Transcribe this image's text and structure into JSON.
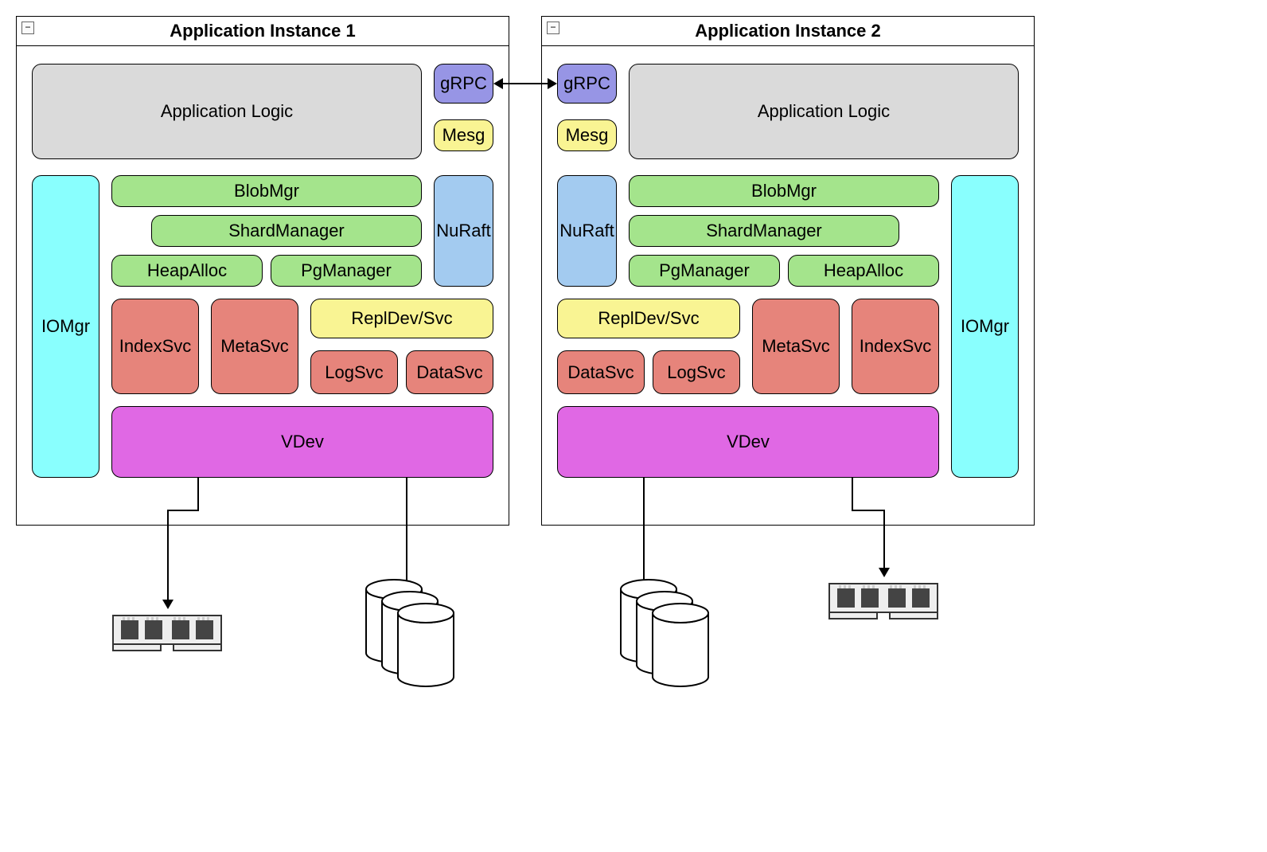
{
  "instance1": {
    "title": "Application Instance 1",
    "appLogic": "Application Logic",
    "grpc": "gRPC",
    "mesg": "Mesg",
    "iomgr": "IOMgr",
    "blobmgr": "BlobMgr",
    "shardmgr": "ShardManager",
    "nuraft": "NuRaft",
    "heapalloc": "HeapAlloc",
    "pgmanager": "PgManager",
    "indexsvc": "IndexSvc",
    "metasvc": "MetaSvc",
    "repldev": "ReplDev/Svc",
    "logsvc": "LogSvc",
    "datasvc": "DataSvc",
    "vdev": "VDev"
  },
  "instance2": {
    "title": "Application Instance 2",
    "appLogic": "Application Logic",
    "grpc": "gRPC",
    "mesg": "Mesg",
    "iomgr": "IOMgr",
    "blobmgr": "BlobMgr",
    "shardmgr": "ShardManager",
    "nuraft": "NuRaft",
    "heapalloc": "HeapAlloc",
    "pgmanager": "PgManager",
    "indexsvc": "IndexSvc",
    "metasvc": "MetaSvc",
    "repldev": "ReplDev/Svc",
    "logsvc": "LogSvc",
    "datasvc": "DataSvc",
    "vdev": "VDev"
  },
  "colors": {
    "appLogic": "#DADADA",
    "grpc": "#9795E5",
    "mesg": "#F9F493",
    "iomgr": "#89FFFE",
    "green": "#A4E48C",
    "nuraft": "#A3CBF0",
    "red": "#E6847B",
    "repldev": "#F9F493",
    "vdev": "#E068E4"
  }
}
